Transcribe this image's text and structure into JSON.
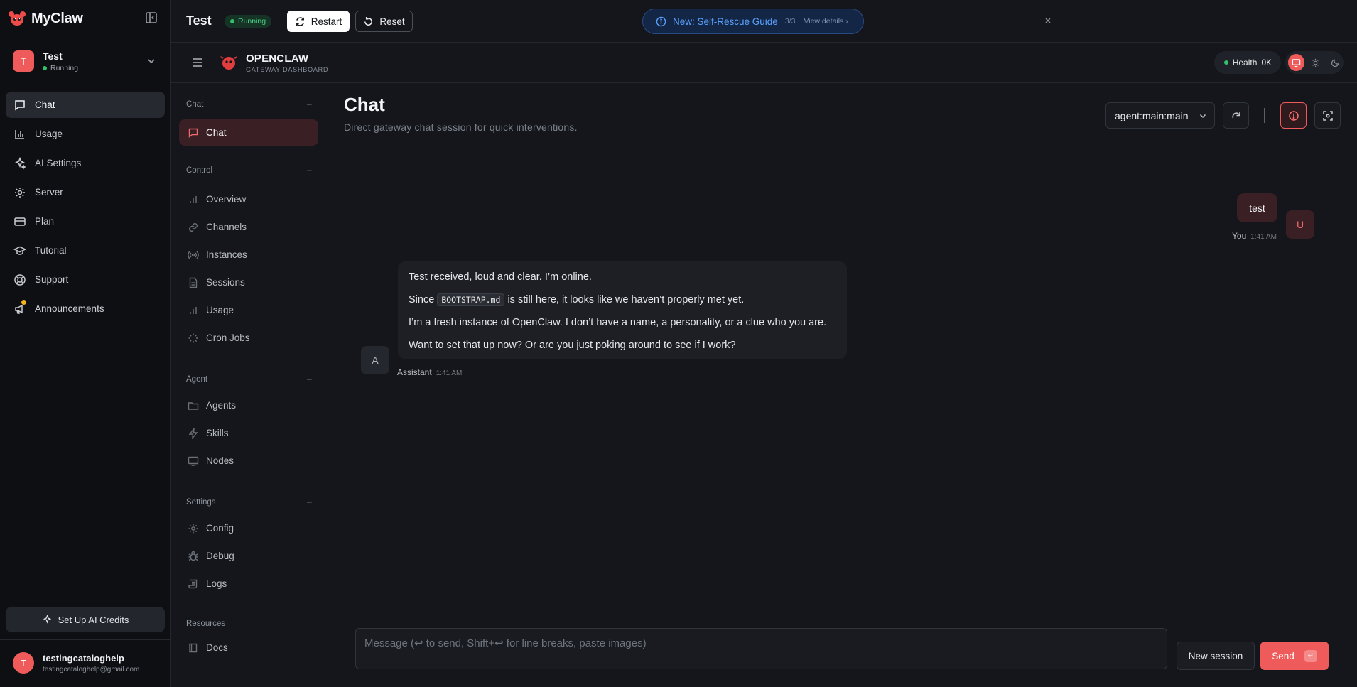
{
  "app": {
    "name": "MyClaw"
  },
  "workspace": {
    "name": "Test",
    "status": "Running",
    "avatar": "T"
  },
  "nav": [
    {
      "label": "Chat",
      "icon": "message-square-icon",
      "active": true
    },
    {
      "label": "Usage",
      "icon": "bar-chart-icon"
    },
    {
      "label": "AI Settings",
      "icon": "sparkles-icon"
    },
    {
      "label": "Server",
      "icon": "gear-icon"
    },
    {
      "label": "Plan",
      "icon": "credit-card-icon"
    },
    {
      "label": "Tutorial",
      "icon": "graduation-cap-icon"
    },
    {
      "label": "Support",
      "icon": "lifebuoy-icon"
    },
    {
      "label": "Announcements",
      "icon": "megaphone-icon",
      "badge": true
    }
  ],
  "credits_button": "Set Up AI Credits",
  "user": {
    "name": "testingcataloghelp",
    "email": "testingcataloghelp@gmail.com",
    "avatar": "T"
  },
  "topbar": {
    "title": "Test",
    "status": "Running",
    "restart": "Restart",
    "reset": "Reset",
    "notice": {
      "text": "New: Self-Rescue Guide",
      "count": "3/3",
      "link": "View details ›"
    }
  },
  "gateway": {
    "title": "OPENCLAW",
    "subtitle": "GATEWAY DASHBOARD",
    "health_label": "Health",
    "health_value": "OK",
    "sections": {
      "chat": "Chat",
      "control": "Control",
      "agent": "Agent",
      "settings": "Settings",
      "resources": "Resources"
    },
    "collapse_symbol": "–",
    "items": {
      "chat": "Chat",
      "overview": "Overview",
      "channels": "Channels",
      "instances": "Instances",
      "sessions": "Sessions",
      "usage": "Usage",
      "cron": "Cron Jobs",
      "agents": "Agents",
      "skills": "Skills",
      "nodes": "Nodes",
      "config": "Config",
      "debug": "Debug",
      "logs": "Logs",
      "docs": "Docs"
    }
  },
  "chat": {
    "title": "Chat",
    "subtitle": "Direct gateway chat session for quick interventions.",
    "agent_select": "agent:main:main",
    "messages": {
      "user": {
        "text": "test",
        "sender": "You",
        "time": "1:41 AM",
        "avatar": "U"
      },
      "assistant": {
        "avatar": "A",
        "sender": "Assistant",
        "time": "1:41 AM",
        "line1": "Test received, loud and clear. I’m online.",
        "line2_pre": "Since",
        "line2_code": "BOOTSTRAP.md",
        "line2_post": "is still here, it looks like we haven’t properly met yet.",
        "line3": "I’m a fresh instance of OpenClaw. I don’t have a name, a personality, or a clue who you are.",
        "line4": "Want to set that up now? Or are you just poking around to see if I work?"
      }
    },
    "composer_placeholder": "Message (↩ to send, Shift+↩ for line breaks, paste images)",
    "new_session": "New session",
    "send": "Send",
    "send_kbd": "↵"
  },
  "colors": {
    "accent": "#ef5a5a",
    "running": "#33c46b",
    "notice": "#5aa2ff"
  }
}
